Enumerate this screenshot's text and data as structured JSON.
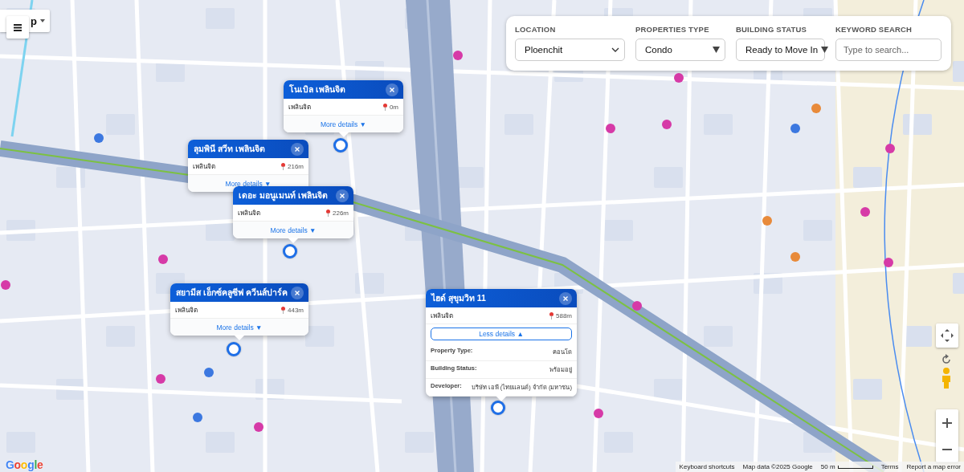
{
  "map_type": {
    "label": "p"
  },
  "filters": [
    {
      "label": "LOCATION",
      "kind": "native_select",
      "value": "Ploenchit"
    },
    {
      "label": "PROPERTIES TYPE",
      "kind": "custom_select",
      "value": "Condo"
    },
    {
      "label": "BUILDING STATUS",
      "kind": "custom_select",
      "value": "Ready to Move In"
    },
    {
      "label": "KEYWORD SEARCH",
      "kind": "text",
      "placeholder": "Type to search..."
    }
  ],
  "popups": [
    {
      "title": "โนเบิล เพลินจิต",
      "area": "เพลินจิต",
      "distance": "0m",
      "toggle": "More details ▼",
      "expanded": false
    },
    {
      "title": "ลุมพินี สวีท เพลินจิต",
      "area": "เพลินจิต",
      "distance": "216m",
      "toggle": "More details ▼",
      "expanded": false
    },
    {
      "title": "เดอะ มอนูเมนท์ เพลินจิต",
      "area": "เพลินจิต",
      "distance": "226m",
      "toggle": "More details ▼",
      "expanded": false
    },
    {
      "title": "สยามีส เอ็กซ์คลูซีฟ ควีนส์ปาร์ค",
      "area": "เพลินจิต",
      "distance": "443m",
      "toggle": "More details ▼",
      "expanded": false
    },
    {
      "title": "ไฮด์ สุขุมวิท 11",
      "area": "เพลินจิต",
      "distance": "588m",
      "toggle": "Less details ▲",
      "expanded": true,
      "details": [
        {
          "label": "Property Type:",
          "value": "คอนโด"
        },
        {
          "label": "Building Status:",
          "value": "พร้อมอยู่"
        },
        {
          "label": "Developer:",
          "value": "บริษัท เอพี (ไทยแลนด์) จำกัด (มหาชน)"
        }
      ]
    }
  ],
  "footer": {
    "logo": "Google",
    "items": [
      {
        "kind": "link",
        "text": "Keyboard shortcuts"
      },
      {
        "kind": "text",
        "text": "Map data ©2025 Google"
      },
      {
        "kind": "scale",
        "text": "50 m"
      },
      {
        "kind": "link",
        "text": "Terms"
      },
      {
        "kind": "link",
        "text": "Report a map error"
      }
    ]
  }
}
